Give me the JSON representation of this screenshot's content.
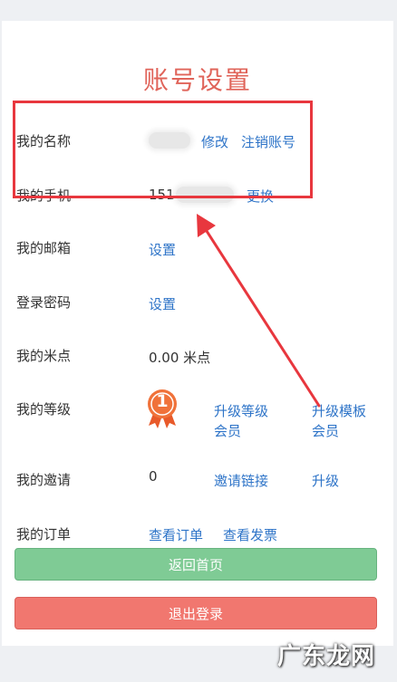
{
  "page_title": "账号设置",
  "rows": {
    "name": {
      "label": "我的名称",
      "actions": [
        "修改",
        "注销账号"
      ]
    },
    "phone": {
      "label": "我的手机",
      "value_prefix": "151",
      "actions": [
        "更换"
      ]
    },
    "email": {
      "label": "我的邮箱",
      "actions": [
        "设置"
      ]
    },
    "password": {
      "label": "登录密码",
      "actions": [
        "设置"
      ]
    },
    "points": {
      "label": "我的米点",
      "value": "0.00 米点"
    },
    "level": {
      "label": "我的等级",
      "badge_number": "1",
      "actions": [
        "升级等级会员",
        "升级模板会员"
      ]
    },
    "invite": {
      "label": "我的邀请",
      "value": "0",
      "actions": [
        "邀请链接",
        "升级"
      ]
    },
    "orders": {
      "label": "我的订单",
      "actions": [
        "查看订单",
        "查看发票"
      ]
    }
  },
  "buttons": {
    "home": "返回首页",
    "logout": "退出登录"
  },
  "watermark": "广东龙网",
  "colors": {
    "title": "#e0645a",
    "link": "#2e74c8",
    "home_button": "#7fcb95",
    "logout_button": "#f1776f",
    "highlight": "#e8373e",
    "badge": "#f0723a"
  }
}
